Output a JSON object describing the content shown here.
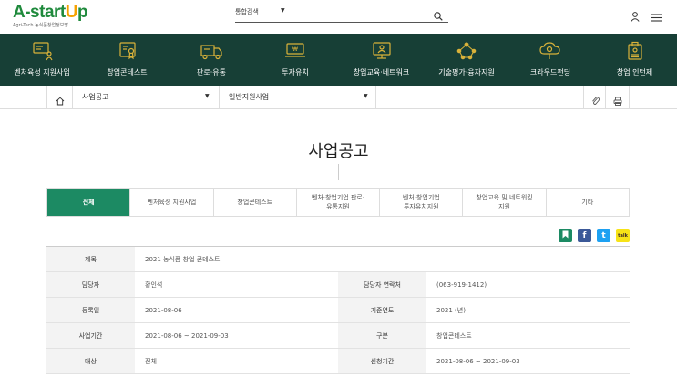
{
  "header": {
    "logo_main": "A-startUp",
    "logo_sub": "Agri-Tech 농식품창업정보망",
    "search_scope": "통합검색",
    "search_placeholder": ""
  },
  "gnb": [
    {
      "label": "벤처육성 지원사업",
      "icon": "presentation-board-icon"
    },
    {
      "label": "창업콘테스트",
      "icon": "certificate-icon"
    },
    {
      "label": "판로·유통",
      "icon": "delivery-truck-icon"
    },
    {
      "label": "투자유치",
      "icon": "money-laptop-icon"
    },
    {
      "label": "창업교육·네트워크",
      "icon": "education-screen-icon"
    },
    {
      "label": "기술평가·융자지원",
      "icon": "network-people-icon"
    },
    {
      "label": "크라우드펀딩",
      "icon": "crowd-funding-icon"
    },
    {
      "label": "창업 인턴제",
      "icon": "id-badge-icon"
    }
  ],
  "breadcrumb": {
    "home_icon": "home-icon",
    "level1": "사업공고",
    "level2": "일반지원사업"
  },
  "page": {
    "title": "사업공고"
  },
  "tabs": [
    {
      "label": "전체",
      "active": true
    },
    {
      "label": "벤처육성 지원사업",
      "active": false
    },
    {
      "label": "창업콘테스트",
      "active": false
    },
    {
      "label": "벤처·창업기업 판로·\n유통지원",
      "active": false
    },
    {
      "label": "벤처·창업기업\n투자유치지원",
      "active": false
    },
    {
      "label": "창업교육 및 네트워킹\n지원",
      "active": false
    },
    {
      "label": "기타",
      "active": false
    }
  ],
  "share": {
    "bookmark": "▮",
    "facebook": "f",
    "twitter": "t",
    "kakao": "talk"
  },
  "info": {
    "subject_label": "제목",
    "subject": "2021 농식품 창업 콘테스트",
    "manager_label": "담당자",
    "manager": "황인석",
    "contact_label": "담당자 연락처",
    "contact": "(063-919-1412)",
    "reg_date_label": "등록일",
    "reg_date": "2021-08-06",
    "base_year_label": "기준연도",
    "base_year": "2021 (년)",
    "period_label": "사업기간",
    "period": "2021-08-06 ~ 2021-09-03",
    "category_label": "구분",
    "category": "창업콘테스트",
    "target_label": "대상",
    "target": "전체",
    "apply_period_label": "신청기간",
    "apply_period": "2021-08-06 ~ 2021-09-03"
  },
  "colors": {
    "nav_bg": "#173f36",
    "tab_active": "#1c8a63",
    "logo_green": "#1f8a3c",
    "logo_accent": "#f5a100"
  }
}
